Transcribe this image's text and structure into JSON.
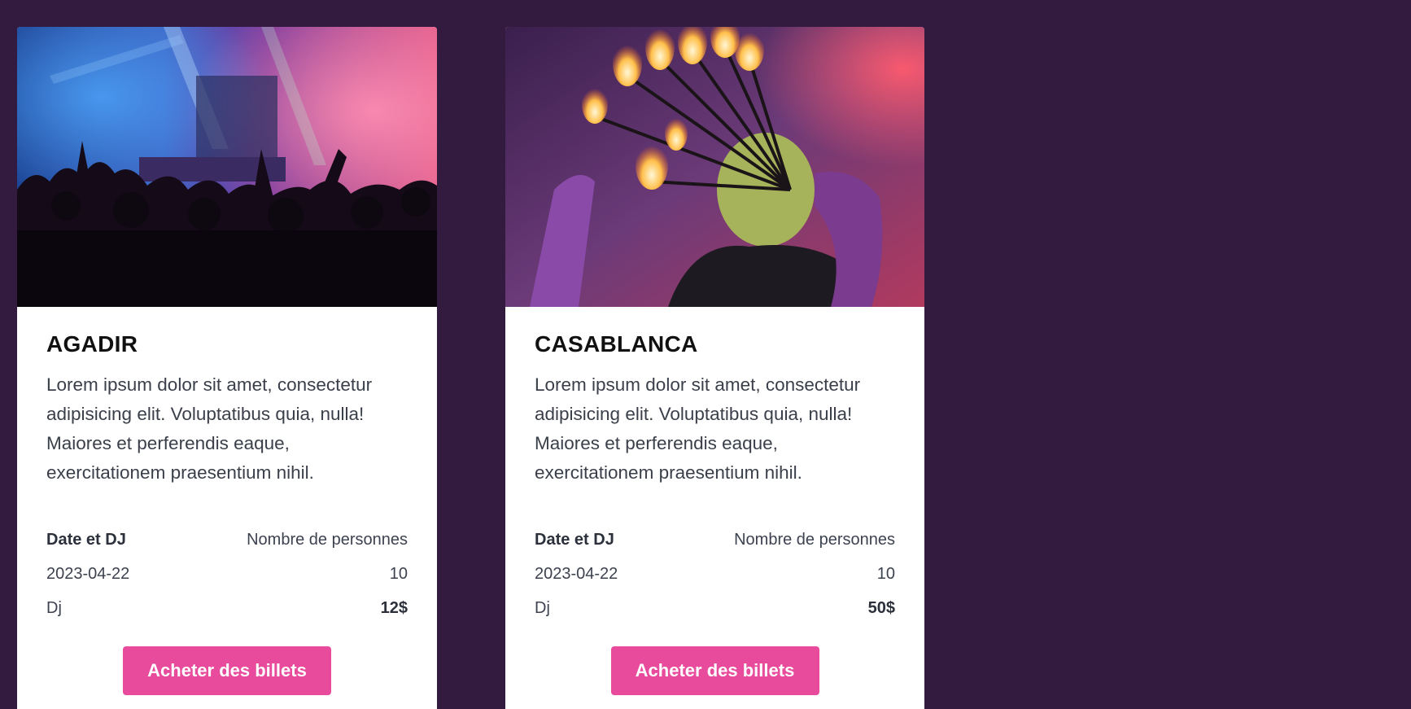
{
  "events": [
    {
      "title": "AGADIR",
      "description": "Lorem ipsum dolor sit amet, consectetur adipisicing elit. Voluptatibus quia, nulla! Maiores et perferendis eaque, exercitationem praesentium nihil.",
      "date_dj_label": "Date et DJ",
      "people_label": "Nombre de personnes",
      "date": "2023-04-22",
      "people": "10",
      "dj": "Dj",
      "price": "12$",
      "button_label": "Acheter des billets"
    },
    {
      "title": "CASABLANCA",
      "description": "Lorem ipsum dolor sit amet, consectetur adipisicing elit. Voluptatibus quia, nulla! Maiores et perferendis eaque, exercitationem praesentium nihil.",
      "date_dj_label": "Date et DJ",
      "people_label": "Nombre de personnes",
      "date": "2023-04-22",
      "people": "10",
      "dj": "Dj",
      "price": "50$",
      "button_label": "Acheter des billets"
    }
  ],
  "colors": {
    "page_background": "#321b3f",
    "button": "#e84a9c",
    "card": "#ffffff"
  }
}
